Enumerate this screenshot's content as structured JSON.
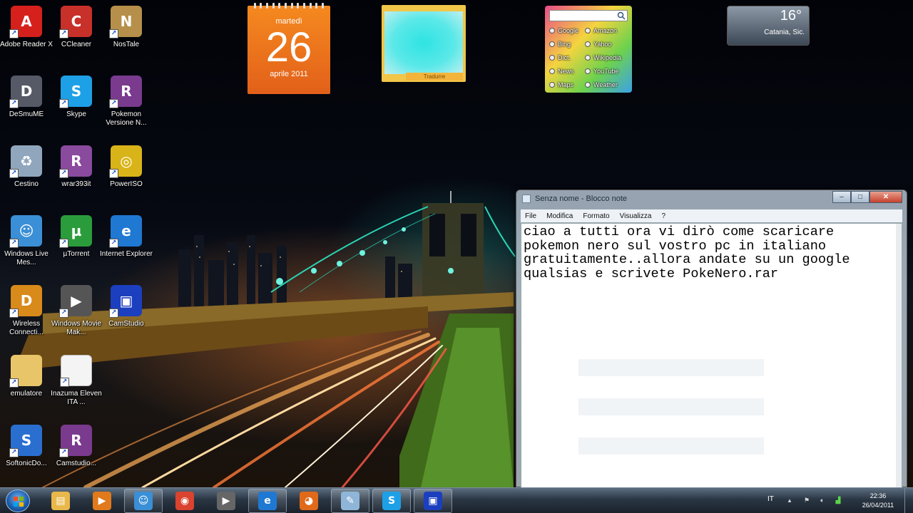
{
  "desktop": {
    "icons": [
      {
        "label": "Adobe Reader X",
        "icon": "adobe-reader-icon",
        "color": "#d6201c",
        "glyph": "A"
      },
      {
        "label": "CCleaner",
        "icon": "ccleaner-icon",
        "color": "#c8302a",
        "glyph": "C"
      },
      {
        "label": "NosTale",
        "icon": "nostale-icon",
        "color": "#b6904a",
        "glyph": "N"
      },
      {
        "label": "DeSmuME",
        "icon": "desmume-icon",
        "color": "#555a66",
        "glyph": "D"
      },
      {
        "label": "Skype",
        "icon": "skype-icon",
        "color": "#1ea0e6",
        "glyph": "S"
      },
      {
        "label": "Pokemon Versione N...",
        "icon": "winrar-archive-icon",
        "color": "#7a3a8e",
        "glyph": "R"
      },
      {
        "label": "Cestino",
        "icon": "recycle-bin-icon",
        "color": "#8fa6bd",
        "glyph": "♻"
      },
      {
        "label": "wrar393it",
        "icon": "winrar-installer-icon",
        "color": "#8a4a9e",
        "glyph": "R"
      },
      {
        "label": "PowerISO",
        "icon": "poweriso-icon",
        "color": "#d9b418",
        "glyph": "◎"
      },
      {
        "label": "Windows Live Mes...",
        "icon": "windows-live-messenger-icon",
        "color": "#3a8fd6",
        "glyph": "☺"
      },
      {
        "label": "µTorrent",
        "icon": "utorrent-icon",
        "color": "#2b9c3b",
        "glyph": "µ"
      },
      {
        "label": "Internet Explorer",
        "icon": "internet-explorer-icon",
        "color": "#1f78d2",
        "glyph": "e"
      },
      {
        "label": "Wireless Connecti...",
        "icon": "dlink-wireless-icon",
        "color": "#d88a1a",
        "glyph": "D"
      },
      {
        "label": "Windows Movie Mak...",
        "icon": "movie-maker-icon",
        "color": "#555",
        "glyph": "▶"
      },
      {
        "label": "CamStudio",
        "icon": "camstudio-icon",
        "color": "#1c3fbf",
        "glyph": "▣"
      },
      {
        "label": "emulatore",
        "icon": "folder-icon",
        "color": "#e9c56a",
        "glyph": ""
      },
      {
        "label": "Inazuma Eleven ITA ...",
        "icon": "document-icon",
        "color": "#f4f4f4",
        "glyph": ""
      },
      {
        "label": "SoftonicDo...",
        "icon": "softonic-downloader-icon",
        "color": "#2a6fd0",
        "glyph": "S"
      },
      {
        "label": "Camstudio...",
        "icon": "winrar-camstudio-icon",
        "color": "#7a3a8e",
        "glyph": "R"
      }
    ]
  },
  "gadgets": {
    "calendar": {
      "weekday": "martedì",
      "day": "26",
      "month_year": "aprile 2011"
    },
    "translator": {
      "button_label": "Tradurre"
    },
    "search": {
      "engines": [
        "Google",
        "Amazon",
        "Bing",
        "Yahoo",
        "Dict.",
        "Wikipedia",
        "News",
        "YouTube",
        "Maps",
        "Weather"
      ]
    },
    "weather": {
      "temperature": "16°",
      "city": "Catania, Sic."
    }
  },
  "notepad": {
    "title": "Senza nome - Blocco note",
    "menu": [
      "File",
      "Modifica",
      "Formato",
      "Visualizza",
      "?"
    ],
    "content": "ciao a tutti ora vi dirò come scaricare\npokemon nero sul vostro pc in italiano\ngratuitamente..allora andate su un google\nqualsias e scrivete PokeNero.rar",
    "controls": {
      "minimize": "–",
      "maximize": "□",
      "close": "✕"
    }
  },
  "taskbar": {
    "pinned": [
      {
        "icon": "explorer-folder-icon",
        "color": "#e9b84a",
        "glyph": "▤",
        "active": false
      },
      {
        "icon": "media-player-icon",
        "color": "#e07a1c",
        "glyph": "▶",
        "active": false
      },
      {
        "icon": "live-messenger-icon",
        "color": "#3a8fd6",
        "glyph": "☺",
        "active": true
      },
      {
        "icon": "chrome-icon",
        "color": "#d9432f",
        "glyph": "◉",
        "active": false
      },
      {
        "icon": "movie-maker-icon",
        "color": "#666",
        "glyph": "▶",
        "active": false
      },
      {
        "icon": "internet-explorer-icon",
        "color": "#1f78d2",
        "glyph": "e",
        "active": true
      },
      {
        "icon": "firefox-icon",
        "color": "#e06a1a",
        "glyph": "◕",
        "active": false
      },
      {
        "icon": "notepad-icon",
        "color": "#8fb6d8",
        "glyph": "✎",
        "active": true
      },
      {
        "icon": "skype-icon",
        "color": "#1ea0e6",
        "glyph": "S",
        "active": true
      },
      {
        "icon": "camstudio-icon",
        "color": "#1c3fbf",
        "glyph": "▣",
        "active": true
      }
    ],
    "tray": {
      "language": "IT"
    },
    "clock": {
      "time": "22:36",
      "date": "26/04/2011"
    }
  }
}
